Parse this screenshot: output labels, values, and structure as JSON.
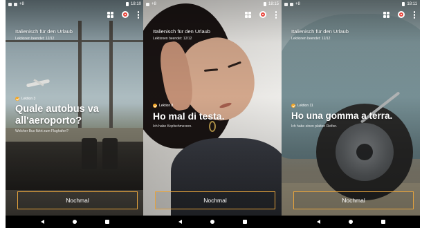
{
  "statusbar": {
    "time_1": "18:10",
    "time_2": "18:15",
    "time_3": "18:11",
    "carrier": "+8"
  },
  "app": {
    "course_title": "Italienisch für den Urlaub",
    "lessons_done": "Lektionen beendet: 12/12",
    "again_label": "Nochmal"
  },
  "icons": {
    "grid": "grid-icon",
    "target": "target-icon",
    "menu": "more-vert-icon",
    "check": "check-circle-icon"
  },
  "colors": {
    "accent": "#e6a33c",
    "target_red": "#e8453c"
  },
  "screens": [
    {
      "lesson": "Lektion 3",
      "phrase": "Quale autobus va all'aeroporto?",
      "translation": "Welcher Bus fährt zum Flughafen?"
    },
    {
      "lesson": "Lektion 8",
      "phrase": "Ho mal di testa.",
      "translation": "Ich habe Kopfschmerzen."
    },
    {
      "lesson": "Lektion 11",
      "phrase": "Ho una gomma a terra.",
      "translation": "Ich habe einen platten Reifen."
    }
  ]
}
